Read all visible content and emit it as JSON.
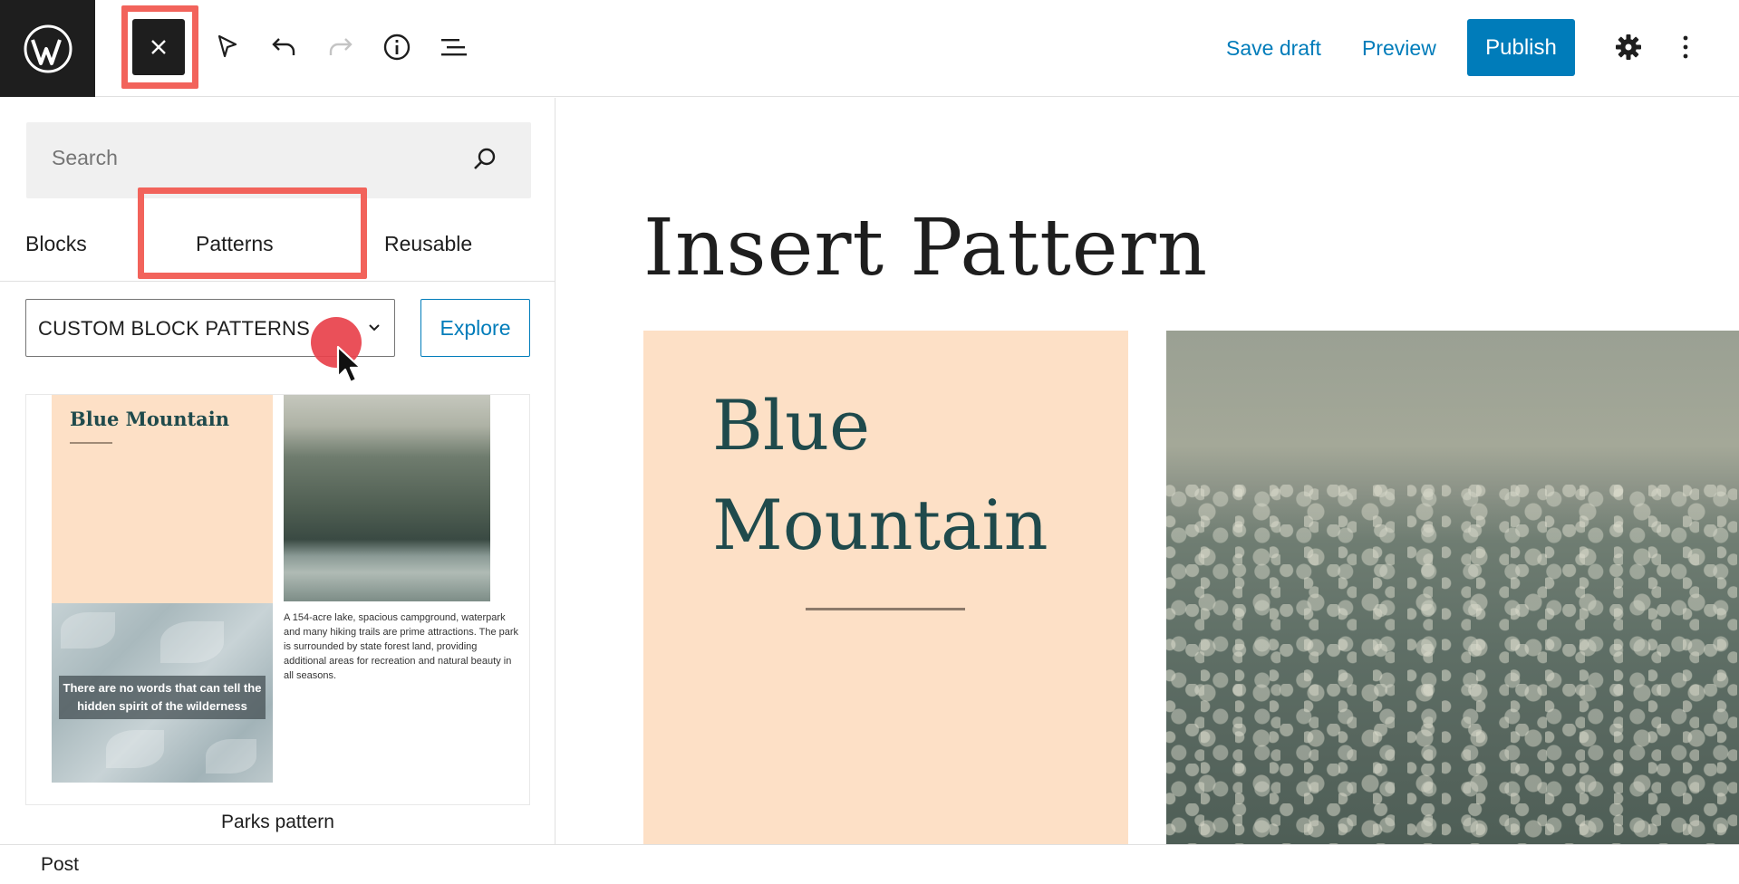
{
  "toolbar": {
    "save_draft": "Save draft",
    "preview": "Preview",
    "publish": "Publish",
    "icons": [
      "wordpress-logo-icon",
      "close-icon",
      "select-tool-icon",
      "undo-icon",
      "redo-icon",
      "info-icon",
      "list-view-icon",
      "gear-icon",
      "more-options-icon"
    ]
  },
  "inserter": {
    "search_placeholder": "Search",
    "tabs": [
      {
        "label": "Blocks"
      },
      {
        "label": "Patterns",
        "selected": true
      },
      {
        "label": "Reusable"
      }
    ],
    "category": "CUSTOM BLOCK PATTERNS",
    "explore": "Explore",
    "pattern": {
      "title": "Blue Mountain",
      "quote": "There are no words that can tell the hidden spirit of the wilderness",
      "description": "A 154-acre lake, spacious campground, waterpark and many hiking trails are prime attractions. The park is surrounded by state forest land, providing additional areas for recreation and natural beauty in all seasons.",
      "caption": "Parks pattern"
    }
  },
  "editor": {
    "post_title": "Insert Pattern",
    "cover_title": "Blue Mountain"
  },
  "footer": {
    "breadcrumb": "Post"
  },
  "colors": {
    "accent": "#007cba",
    "highlight": "#f2635b",
    "peach": "#fde0c6",
    "teal_text": "#1f4a4c"
  }
}
